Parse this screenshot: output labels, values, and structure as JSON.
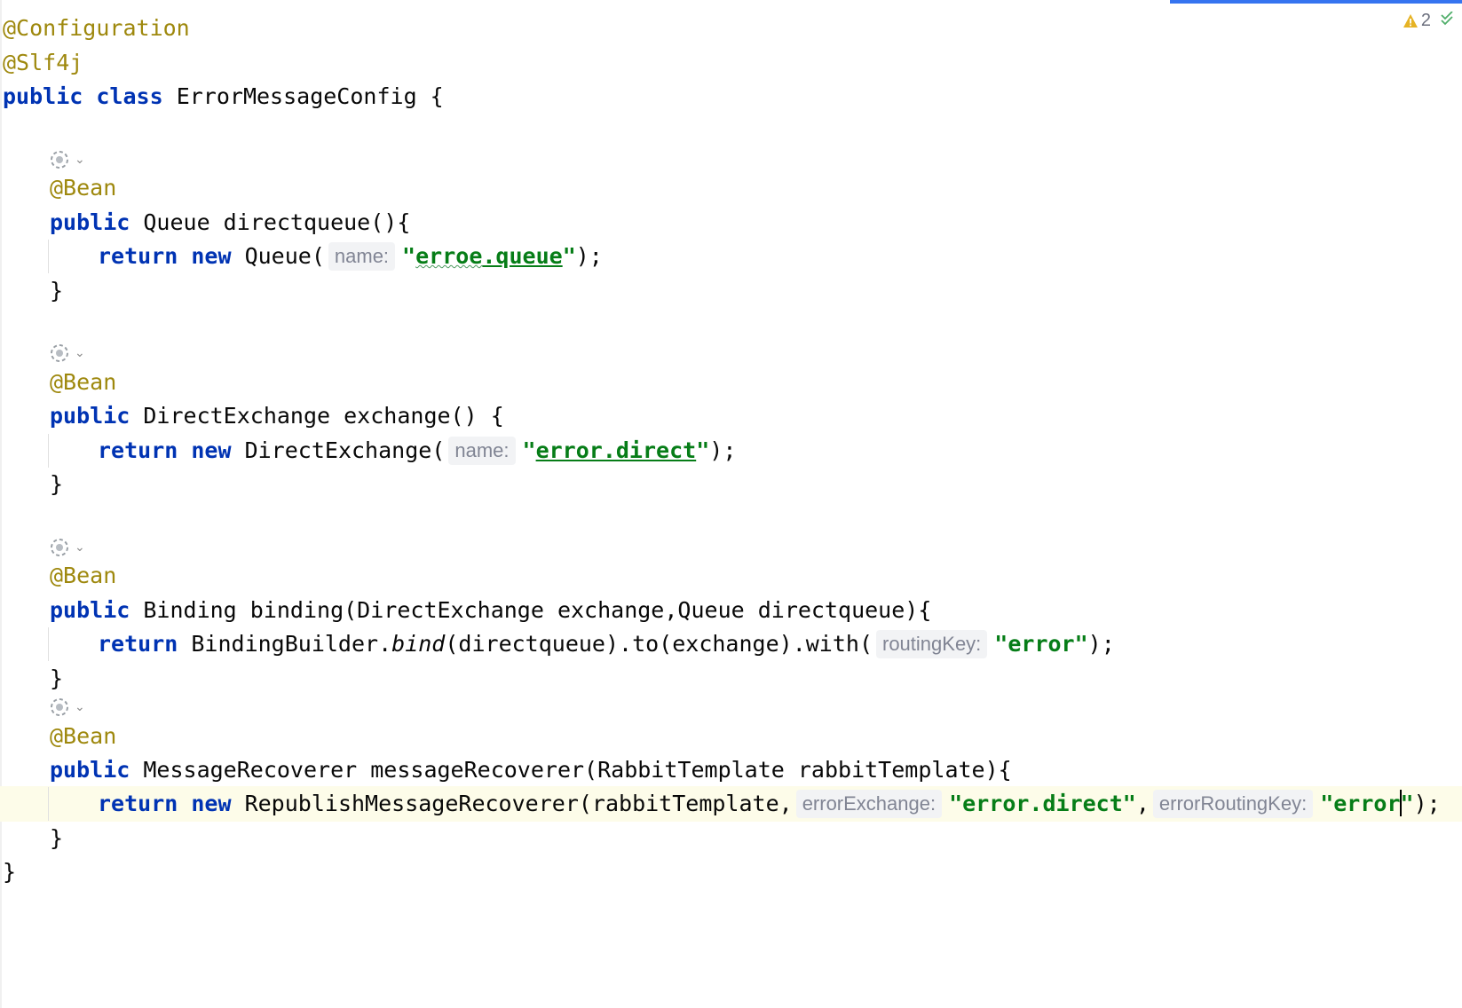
{
  "editor": {
    "inspection": {
      "warning_count": "2",
      "warning_icon": "warning-triangle-icon",
      "status_icon": "double-check-icon"
    },
    "gutter_icon": "spring-bean-icon",
    "colors": {
      "keyword": "#0033b3",
      "annotation": "#9e880d",
      "string": "#067d17",
      "hint_background": "#f2f3f5",
      "hint_text": "#818594",
      "current_line": "#fdfce9",
      "progress": "#3574f0"
    },
    "code": {
      "annotation_configuration": "@Configuration",
      "annotation_slf4j": "@Slf4j",
      "kw_public": "public",
      "kw_class": "class",
      "class_decl_rest": " ErrorMessageConfig {",
      "annotation_bean": "@Bean",
      "kw_return": "return",
      "kw_new": "new",
      "queue_method_rest": " Queue directqueue(){",
      "queue_ctor": " Queue(",
      "queue_hint": "name:",
      "queue_string_quote_open": "\"",
      "queue_string_word1": "erroe",
      "queue_string_word2": ".queue",
      "queue_string_quote_close": "\"",
      "queue_end": ");",
      "close_brace": "}",
      "exchange_method_rest": " DirectExchange exchange() {",
      "exchange_ctor": " DirectExchange(",
      "exchange_hint": "name:",
      "exchange_string_quote_open": "\"",
      "exchange_string_word": "error.direct",
      "exchange_string_quote_close": "\"",
      "exchange_end": ");",
      "binding_method_rest": " Binding binding(DirectExchange exchange,Queue directqueue){",
      "binding_builder": " BindingBuilder.",
      "binding_bind": "bind",
      "binding_rest": "(directqueue).to(exchange).with(",
      "binding_hint": "routingKey:",
      "binding_string": "\"error\"",
      "binding_end": ");",
      "recoverer_method_rest": " MessageRecoverer messageRecoverer(RabbitTemplate rabbitTemplate){",
      "recoverer_ctor": " RepublishMessageRecoverer(rabbitTemplate,",
      "recoverer_hint1": "errorExchange:",
      "recoverer_string1": "\"error.direct\"",
      "recoverer_comma": ",",
      "recoverer_hint2": "errorRoutingKey:",
      "recoverer_string2_before_caret": "\"error",
      "recoverer_string2_after_caret": "\"",
      "recoverer_end": ");",
      "class_close": "}"
    }
  }
}
